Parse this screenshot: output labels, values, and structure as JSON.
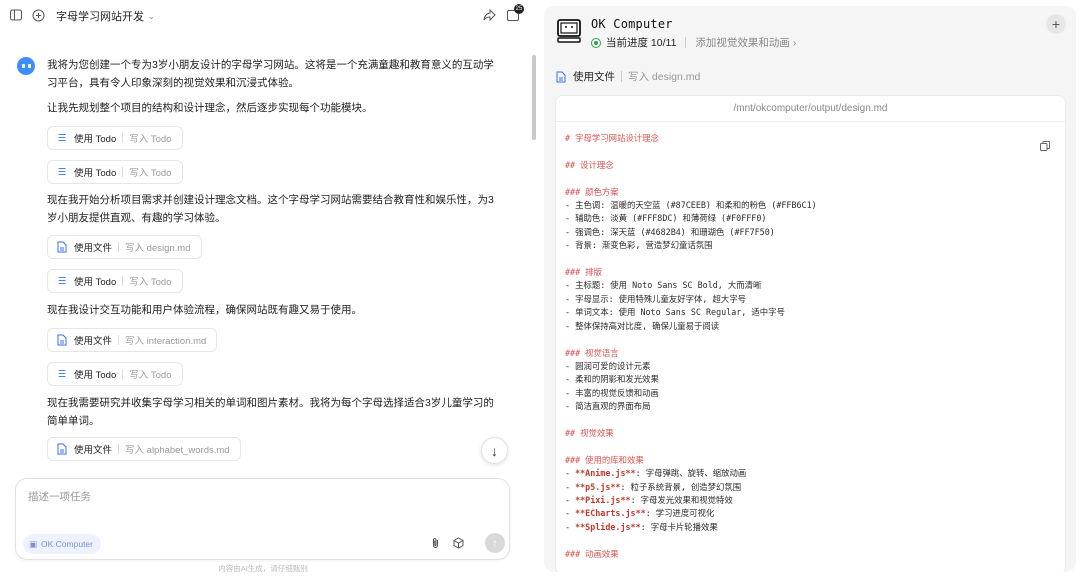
{
  "header": {
    "project_title": "字母学习网站开发",
    "badge_count": "25"
  },
  "chat": {
    "messages": [
      "我将为您创建一个专为3岁小朋友设计的字母学习网站。这将是一个充满童趣和教育意义的互动学习平台，具有令人印象深刻的视觉效果和沉浸式体验。",
      "让我先规划整个项目的结构和设计理念，然后逐步实现每个功能模块。",
      "现在我开始分析项目需求并创建设计理念文档。这个字母学习网站需要结合教育性和娱乐性，为3岁小朋友提供直观、有趣的学习体验。",
      "现在我设计交互功能和用户体验流程，确保网站既有趣又易于使用。",
      "现在我需要研究并收集字母学习相关的单词和图片素材。我将为每个字母选择适合3岁儿童学习的简单单词。"
    ],
    "tools": [
      {
        "name": "使用 Todo",
        "detail": "写入 Todo"
      },
      {
        "name": "使用 Todo",
        "detail": "写入 Todo"
      },
      {
        "name": "使用文件",
        "detail": "写入 design.md"
      },
      {
        "name": "使用 Todo",
        "detail": "写入 Todo"
      },
      {
        "name": "使用文件",
        "detail": "写入 interaction.md"
      },
      {
        "name": "使用 Todo",
        "detail": "写入 Todo"
      },
      {
        "name": "使用文件",
        "detail": "写入 alphabet_words.md"
      }
    ]
  },
  "input": {
    "placeholder": "描述一项任务",
    "agent_chip": "OK Computer"
  },
  "footer": {
    "disclaimer": "内容由AI生成，请仔细甄别"
  },
  "computer": {
    "title": "OK Computer",
    "progress_label": "当前进度 10/11",
    "next_step": "添加视觉效果和动画 ›",
    "tool_name": "使用文件",
    "tool_detail": "写入 design.md",
    "file_path": "/mnt/okcomputer/output/design.md",
    "file_lines": [
      [
        "h",
        "# 字母学习网站设计理念"
      ],
      [
        "",
        ""
      ],
      [
        "h",
        "## 设计理念"
      ],
      [
        "",
        ""
      ],
      [
        "h",
        "### 颜色方案"
      ],
      [
        "",
        "- 主色调: 温暖的天空蓝 (#87CEEB) 和柔和的粉色 (#FFB6C1)"
      ],
      [
        "",
        "- 辅助色: 淡黄 (#FFF8DC) 和薄荷绿 (#F0FFF0)"
      ],
      [
        "",
        "- 强调色: 深天蓝 (#4682B4) 和珊瑚色 (#FF7F50)"
      ],
      [
        "",
        "- 背景: 渐变色彩, 营造梦幻童话氛围"
      ],
      [
        "",
        ""
      ],
      [
        "h",
        "### 排版"
      ],
      [
        "",
        "- 主标题: 使用 Noto Sans SC Bold, 大而清晰"
      ],
      [
        "",
        "- 字母显示: 使用特殊儿童友好字体, 超大字号"
      ],
      [
        "",
        "- 单词文本: 使用 Noto Sans SC Regular, 适中字号"
      ],
      [
        "",
        "- 整体保持高对比度, 确保儿童易于阅读"
      ],
      [
        "",
        ""
      ],
      [
        "h",
        "### 视觉语言"
      ],
      [
        "",
        "- 圆润可爱的设计元素"
      ],
      [
        "",
        "- 柔和的阴影和发光效果"
      ],
      [
        "",
        "- 丰富的视觉反馈和动画"
      ],
      [
        "",
        "- 简洁直观的界面布局"
      ],
      [
        "",
        ""
      ],
      [
        "h",
        "## 视觉效果"
      ],
      [
        "",
        ""
      ],
      [
        "h",
        "### 使用的库和效果"
      ],
      [
        "b",
        "- **Anime.js**: 字母弹跳、旋转、缩放动画"
      ],
      [
        "b",
        "- **p5.js**: 粒子系统背景, 创造梦幻氛围"
      ],
      [
        "b",
        "- **Pixi.js**: 字母发光效果和视觉特效"
      ],
      [
        "b",
        "- **ECharts.js**: 学习进度可视化"
      ],
      [
        "b",
        "- **Splide.js**: 字母卡片轮播效果"
      ],
      [
        "",
        ""
      ],
      [
        "h",
        "### 动画效果"
      ]
    ]
  }
}
